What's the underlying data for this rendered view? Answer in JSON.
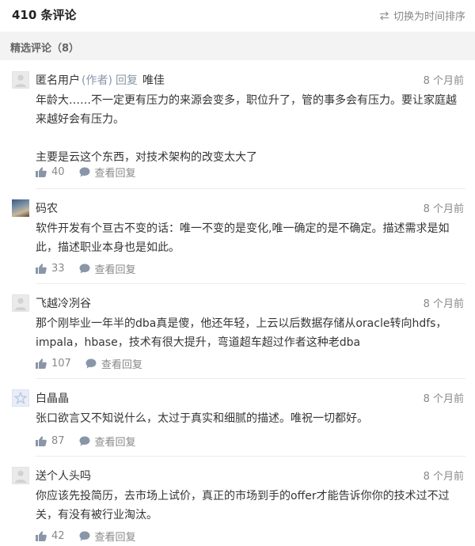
{
  "header": {
    "total": "410 条评论",
    "sort_label": "切换为时间排序"
  },
  "section": {
    "title": "精选评论（8）"
  },
  "comments": [
    {
      "author": "匿名用户",
      "author_tag": "(作者)",
      "reply_label": "回复",
      "reply_to": "唯佳",
      "time": "8 个月前",
      "paragraphs": [
        "年龄大……不一定更有压力的来源会变多，职位升了，管的事多会有压力。要让家庭越来越好会有压力。",
        "主要是云这个东西，对技术架构的改变太大了"
      ],
      "likes": "40",
      "view_label": "查看回复"
    },
    {
      "author": "码农",
      "time": "8 个月前",
      "paragraphs": [
        "软件开发有个亘古不变的话：唯一不变的是变化,唯一确定的是不确定。描述需求是如此，描述职业本身也是如此。"
      ],
      "likes": "33",
      "view_label": "查看回复"
    },
    {
      "author": "飞越冷冽谷",
      "time": "8 个月前",
      "paragraphs": [
        "那个刚毕业一年半的dba真是傻，他还年轻，上云以后数据存储从oracle转向hdfs，impala，hbase，技术有很大提升，弯道超车超过作者这种老dba"
      ],
      "likes": "107",
      "view_label": "查看回复"
    },
    {
      "author": "白晶晶",
      "time": "8 个月前",
      "paragraphs": [
        "张口欲言又不知说什么，太过于真实和细腻的描述。唯祝一切都好。"
      ],
      "likes": "87",
      "view_label": "查看回复"
    },
    {
      "author": "送个人头吗",
      "time": "8 个月前",
      "paragraphs": [
        "你应该先投简历，去市场上试价，真正的市场到手的offer才能告诉你你的技术过不过关，有没有被行业淘汰。"
      ],
      "likes": "42",
      "view_label": "查看回复"
    }
  ],
  "colors": {
    "text": "#353535",
    "muted": "#888888",
    "link": "#8a96a8",
    "section_bg": "#f3f3f3",
    "divider": "#ececec"
  },
  "icons": [
    "sort-swap-icon",
    "thumb-up-icon",
    "comment-bubble-icon",
    "avatar-placeholder-icon",
    "star-avatar-icon"
  ]
}
